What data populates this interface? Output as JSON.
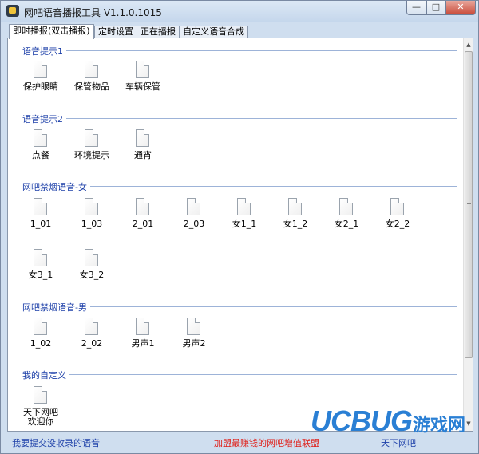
{
  "window": {
    "title": "网吧语音播报工具 V1.1.0.1015"
  },
  "window_controls": {
    "minimize": "—",
    "maximize": "□",
    "close": "✕"
  },
  "tabs": [
    {
      "label": "即时播报(双击播报)"
    },
    {
      "label": "定时设置"
    },
    {
      "label": "正在播报"
    },
    {
      "label": "自定义语音合成"
    }
  ],
  "sections": [
    {
      "title": "语音提示1",
      "files": [
        "保护眼睛",
        "保管物品",
        "车辆保管"
      ]
    },
    {
      "title": "语音提示2",
      "files": [
        "点餐",
        "环境提示",
        "通宵"
      ]
    },
    {
      "title": "网吧禁烟语音-女",
      "files": [
        "1_01",
        "1_03",
        "2_01",
        "2_03",
        "女1_1",
        "女1_2",
        "女2_1",
        "女2_2",
        "女3_1",
        "女3_2"
      ]
    },
    {
      "title": "网吧禁烟语音-男",
      "files": [
        "1_02",
        "2_02",
        "男声1",
        "男声2"
      ]
    },
    {
      "title": "我的自定义",
      "files": [
        "天下网吧欢迎你"
      ]
    }
  ],
  "statusbar": {
    "left_link": "我要提交没收录的语音",
    "center_link": "加盟最赚钱的网吧增值联盟",
    "right_link": "天下网吧"
  },
  "watermark": {
    "brand": "UCBUG",
    "cn": "游戏网"
  },
  "colors": {
    "section_title": "#1c3fa8",
    "status_link": "#1c3fa8",
    "promo_link": "#e0201a",
    "window_frame": "#cfdeef"
  }
}
